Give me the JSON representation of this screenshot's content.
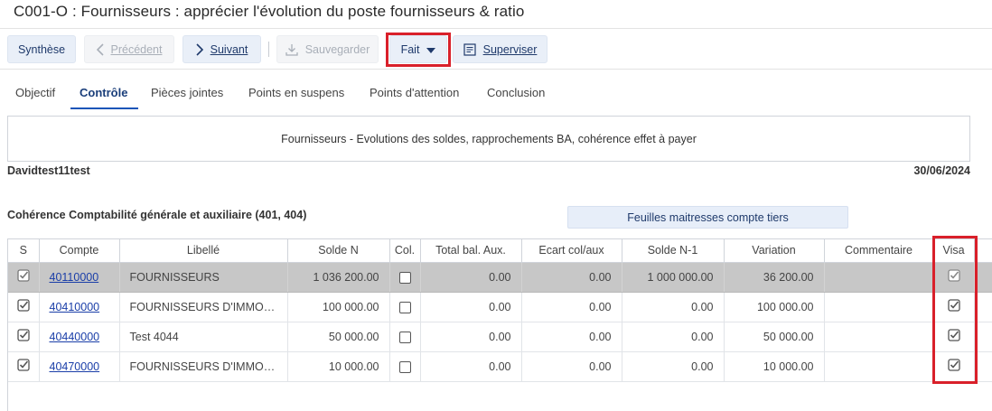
{
  "page": {
    "title": "C001-O : Fournisseurs : apprécier l'évolution du poste fournisseurs & ratio"
  },
  "toolbar": {
    "synthese": "Synthèse",
    "precedent": "Précédent",
    "suivant": "Suivant",
    "sauvegarder": "Sauvegarder",
    "fait": "Fait",
    "superviser": "Superviser"
  },
  "tabs": [
    "Objectif",
    "Contrôle",
    "Pièces jointes",
    "Points en suspens",
    "Points d'attention",
    "Conclusion"
  ],
  "active_tab": "Contrôle",
  "description": "Fournisseurs - Evolutions des soldes, rapprochements BA, cohérence effet à payer",
  "user": "Davidtest11test",
  "date": "30/06/2024",
  "section_title": "Cohérence Comptabilité générale et auxiliaire (401, 404)",
  "feuilles_button": "Feuilles maitresses compte tiers",
  "table": {
    "headers": [
      "S",
      "Compte",
      "Libellé",
      "Solde N",
      "Col.",
      "Total bal. Aux.",
      "Ecart col/aux",
      "Solde N-1",
      "Variation",
      "Commentaire",
      "Visa"
    ],
    "rows": [
      {
        "s": true,
        "compte": "40110000",
        "libelle": "FOURNISSEURS",
        "solde_n": "1 036 200.00",
        "col": false,
        "total_bal_aux": "0.00",
        "ecart": "0.00",
        "solde_n1": "1 000 000.00",
        "variation": "36 200.00",
        "commentaire": "",
        "visa": true,
        "selected": true
      },
      {
        "s": true,
        "compte": "40410000",
        "libelle": "FOURNISSEURS D'IMMOB...",
        "solde_n": "100 000.00",
        "col": false,
        "total_bal_aux": "0.00",
        "ecart": "0.00",
        "solde_n1": "0.00",
        "variation": "100 000.00",
        "commentaire": "",
        "visa": true,
        "selected": false
      },
      {
        "s": true,
        "compte": "40440000",
        "libelle": "Test 4044",
        "solde_n": "50 000.00",
        "col": false,
        "total_bal_aux": "0.00",
        "ecart": "0.00",
        "solde_n1": "0.00",
        "variation": "50 000.00",
        "commentaire": "",
        "visa": true,
        "selected": false
      },
      {
        "s": true,
        "compte": "40470000",
        "libelle": "FOURNISSEURS D'IMMOB...",
        "solde_n": "10 000.00",
        "col": false,
        "total_bal_aux": "0.00",
        "ecart": "0.00",
        "solde_n1": "0.00",
        "variation": "10 000.00",
        "commentaire": "",
        "visa": true,
        "selected": false
      }
    ]
  },
  "colors": {
    "highlight": "#d9202a",
    "accent": "#1c55b8",
    "link": "#1a3ea8",
    "selected_row": "#c7c7c7"
  }
}
